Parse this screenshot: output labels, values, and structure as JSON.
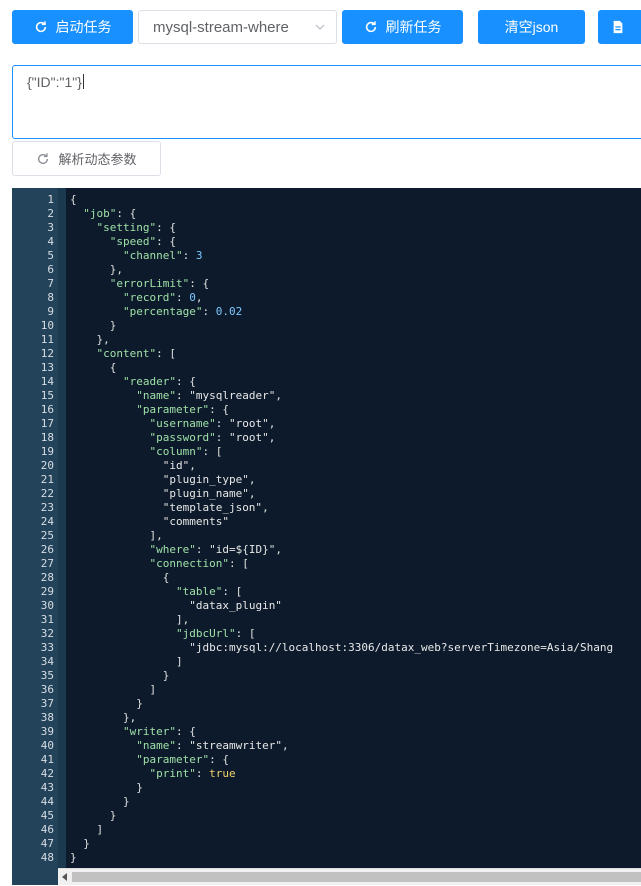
{
  "toolbar": {
    "start_label": "启动任务",
    "select_value": "mysql-stream-where",
    "refresh_label": "刷新任务",
    "clear_label": "清空json",
    "parse_label": "解析动态参数"
  },
  "param_input": {
    "value": "{\"ID\":\"1\"}"
  },
  "colors": {
    "primary": "#1890ff",
    "editor_bg": "#0c1a2b",
    "gutter_bg": "#23435a",
    "key_color": "#9fe0a7",
    "number_color": "#7ec8ff",
    "bool_color": "#f1d36b"
  },
  "editor": {
    "line_numbers": [
      "1",
      "2",
      "3",
      "4",
      "5",
      "6",
      "7",
      "8",
      "9",
      "10",
      "11",
      "12",
      "13",
      "14",
      "15",
      "16",
      "17",
      "18",
      "19",
      "20",
      "21",
      "22",
      "23",
      "24",
      "25",
      "26",
      "27",
      "28",
      "29",
      "30",
      "31",
      "32",
      "33",
      "34",
      "35",
      "36",
      "37",
      "38",
      "39",
      "40",
      "41",
      "42",
      "43",
      "44",
      "45",
      "46",
      "47",
      "48"
    ],
    "lines": [
      [
        {
          "t": "{",
          "c": "p"
        }
      ],
      [
        {
          "t": "  ",
          "c": "p"
        },
        {
          "t": "\"job\"",
          "c": "k"
        },
        {
          "t": ": {",
          "c": "p"
        }
      ],
      [
        {
          "t": "    ",
          "c": "p"
        },
        {
          "t": "\"setting\"",
          "c": "k"
        },
        {
          "t": ": {",
          "c": "p"
        }
      ],
      [
        {
          "t": "      ",
          "c": "p"
        },
        {
          "t": "\"speed\"",
          "c": "k"
        },
        {
          "t": ": {",
          "c": "p"
        }
      ],
      [
        {
          "t": "        ",
          "c": "p"
        },
        {
          "t": "\"channel\"",
          "c": "k"
        },
        {
          "t": ": ",
          "c": "p"
        },
        {
          "t": "3",
          "c": "n"
        }
      ],
      [
        {
          "t": "      },",
          "c": "p"
        }
      ],
      [
        {
          "t": "      ",
          "c": "p"
        },
        {
          "t": "\"errorLimit\"",
          "c": "k"
        },
        {
          "t": ": {",
          "c": "p"
        }
      ],
      [
        {
          "t": "        ",
          "c": "p"
        },
        {
          "t": "\"record\"",
          "c": "k"
        },
        {
          "t": ": ",
          "c": "p"
        },
        {
          "t": "0",
          "c": "n"
        },
        {
          "t": ",",
          "c": "p"
        }
      ],
      [
        {
          "t": "        ",
          "c": "p"
        },
        {
          "t": "\"percentage\"",
          "c": "k"
        },
        {
          "t": ": ",
          "c": "p"
        },
        {
          "t": "0.02",
          "c": "n"
        }
      ],
      [
        {
          "t": "      }",
          "c": "p"
        }
      ],
      [
        {
          "t": "    },",
          "c": "p"
        }
      ],
      [
        {
          "t": "    ",
          "c": "p"
        },
        {
          "t": "\"content\"",
          "c": "k"
        },
        {
          "t": ": [",
          "c": "p"
        }
      ],
      [
        {
          "t": "      {",
          "c": "p"
        }
      ],
      [
        {
          "t": "        ",
          "c": "p"
        },
        {
          "t": "\"reader\"",
          "c": "k"
        },
        {
          "t": ": {",
          "c": "p"
        }
      ],
      [
        {
          "t": "          ",
          "c": "p"
        },
        {
          "t": "\"name\"",
          "c": "k"
        },
        {
          "t": ": ",
          "c": "p"
        },
        {
          "t": "\"mysqlreader\"",
          "c": "s"
        },
        {
          "t": ",",
          "c": "p"
        }
      ],
      [
        {
          "t": "          ",
          "c": "p"
        },
        {
          "t": "\"parameter\"",
          "c": "k"
        },
        {
          "t": ": {",
          "c": "p"
        }
      ],
      [
        {
          "t": "            ",
          "c": "p"
        },
        {
          "t": "\"username\"",
          "c": "k"
        },
        {
          "t": ": ",
          "c": "p"
        },
        {
          "t": "\"root\"",
          "c": "s"
        },
        {
          "t": ",",
          "c": "p"
        }
      ],
      [
        {
          "t": "            ",
          "c": "p"
        },
        {
          "t": "\"password\"",
          "c": "k"
        },
        {
          "t": ": ",
          "c": "p"
        },
        {
          "t": "\"root\"",
          "c": "s"
        },
        {
          "t": ",",
          "c": "p"
        }
      ],
      [
        {
          "t": "            ",
          "c": "p"
        },
        {
          "t": "\"column\"",
          "c": "k"
        },
        {
          "t": ": [",
          "c": "p"
        }
      ],
      [
        {
          "t": "              ",
          "c": "p"
        },
        {
          "t": "\"id\"",
          "c": "s"
        },
        {
          "t": ",",
          "c": "p"
        }
      ],
      [
        {
          "t": "              ",
          "c": "p"
        },
        {
          "t": "\"plugin_type\"",
          "c": "s"
        },
        {
          "t": ",",
          "c": "p"
        }
      ],
      [
        {
          "t": "              ",
          "c": "p"
        },
        {
          "t": "\"plugin_name\"",
          "c": "s"
        },
        {
          "t": ",",
          "c": "p"
        }
      ],
      [
        {
          "t": "              ",
          "c": "p"
        },
        {
          "t": "\"template_json\"",
          "c": "s"
        },
        {
          "t": ",",
          "c": "p"
        }
      ],
      [
        {
          "t": "              ",
          "c": "p"
        },
        {
          "t": "\"comments\"",
          "c": "s"
        }
      ],
      [
        {
          "t": "            ],",
          "c": "p"
        }
      ],
      [
        {
          "t": "            ",
          "c": "p"
        },
        {
          "t": "\"where\"",
          "c": "k"
        },
        {
          "t": ": ",
          "c": "p"
        },
        {
          "t": "\"id=${ID}\"",
          "c": "s"
        },
        {
          "t": ",",
          "c": "p"
        }
      ],
      [
        {
          "t": "            ",
          "c": "p"
        },
        {
          "t": "\"connection\"",
          "c": "k"
        },
        {
          "t": ": [",
          "c": "p"
        }
      ],
      [
        {
          "t": "              {",
          "c": "p"
        }
      ],
      [
        {
          "t": "                ",
          "c": "p"
        },
        {
          "t": "\"table\"",
          "c": "k"
        },
        {
          "t": ": [",
          "c": "p"
        }
      ],
      [
        {
          "t": "                  ",
          "c": "p"
        },
        {
          "t": "\"datax_plugin\"",
          "c": "s"
        }
      ],
      [
        {
          "t": "                ],",
          "c": "p"
        }
      ],
      [
        {
          "t": "                ",
          "c": "p"
        },
        {
          "t": "\"jdbcUrl\"",
          "c": "k"
        },
        {
          "t": ": [",
          "c": "p"
        }
      ],
      [
        {
          "t": "                  ",
          "c": "p"
        },
        {
          "t": "\"jdbc:mysql://localhost:3306/datax_web?serverTimezone=Asia/Shang",
          "c": "s"
        }
      ],
      [
        {
          "t": "                ]",
          "c": "p"
        }
      ],
      [
        {
          "t": "              }",
          "c": "p"
        }
      ],
      [
        {
          "t": "            ]",
          "c": "p"
        }
      ],
      [
        {
          "t": "          }",
          "c": "p"
        }
      ],
      [
        {
          "t": "        },",
          "c": "p"
        }
      ],
      [
        {
          "t": "        ",
          "c": "p"
        },
        {
          "t": "\"writer\"",
          "c": "k"
        },
        {
          "t": ": {",
          "c": "p"
        }
      ],
      [
        {
          "t": "          ",
          "c": "p"
        },
        {
          "t": "\"name\"",
          "c": "k"
        },
        {
          "t": ": ",
          "c": "p"
        },
        {
          "t": "\"streamwriter\"",
          "c": "s"
        },
        {
          "t": ",",
          "c": "p"
        }
      ],
      [
        {
          "t": "          ",
          "c": "p"
        },
        {
          "t": "\"parameter\"",
          "c": "k"
        },
        {
          "t": ": {",
          "c": "p"
        }
      ],
      [
        {
          "t": "            ",
          "c": "p"
        },
        {
          "t": "\"print\"",
          "c": "k"
        },
        {
          "t": ": ",
          "c": "p"
        },
        {
          "t": "true",
          "c": "b"
        }
      ],
      [
        {
          "t": "          }",
          "c": "p"
        }
      ],
      [
        {
          "t": "        }",
          "c": "p"
        }
      ],
      [
        {
          "t": "      }",
          "c": "p"
        }
      ],
      [
        {
          "t": "    ]",
          "c": "p"
        }
      ],
      [
        {
          "t": "  }",
          "c": "p"
        }
      ],
      [
        {
          "t": "}",
          "c": "p"
        }
      ]
    ]
  }
}
